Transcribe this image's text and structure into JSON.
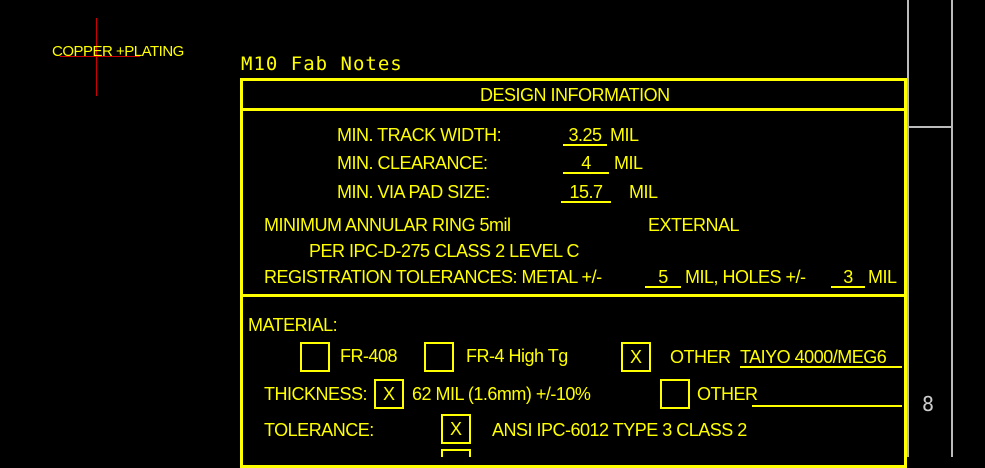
{
  "layer_label": "COPPER +PLATING",
  "sheet_title": "M10 Fab Notes",
  "design_info": {
    "header": "DESIGN INFORMATION",
    "min_track_label": "MIN. TRACK WIDTH:",
    "min_track_value": "3.25",
    "min_track_unit": "MIL",
    "min_clearance_label": "MIN. CLEARANCE:",
    "min_clearance_value": "4",
    "min_clearance_unit": "MIL",
    "min_via_label": "MIN. VIA PAD SIZE:",
    "min_via_value": "15.7",
    "min_via_unit": "MIL",
    "annular_ring": "MINIMUM ANNULAR RING 5mil",
    "external": "EXTERNAL",
    "ipc_ref": "PER IPC-D-275 CLASS 2 LEVEL C",
    "registration_label": "REGISTRATION TOLERANCES: METAL +/-",
    "registration_metal_value": "5",
    "registration_mid": "MIL, HOLES +/-",
    "registration_holes_value": "3",
    "registration_unit": "MIL"
  },
  "material": {
    "label": "MATERIAL:",
    "options": [
      {
        "label": "FR-408",
        "mark": ""
      },
      {
        "label": "FR-4 High Tg",
        "mark": ""
      },
      {
        "label": "OTHER",
        "mark": "X"
      }
    ],
    "other_value": "TAIYO 4000/MEG6",
    "thickness_label": "THICKNESS:",
    "thickness_mark": "X",
    "thickness_value": "62 MIL (1.6mm) +/-10%",
    "thickness_other_mark": "",
    "thickness_other_label": "OTHER",
    "tolerance_label": "TOLERANCE:",
    "tolerance_mark": "X",
    "tolerance_value": "ANSI IPC-6012 TYPE 3 CLASS 2"
  },
  "side_marker": "8",
  "colors": {
    "ink": "#ffff00",
    "background": "#000000",
    "grid": "#cccccc",
    "cursor": "#cc0000"
  }
}
